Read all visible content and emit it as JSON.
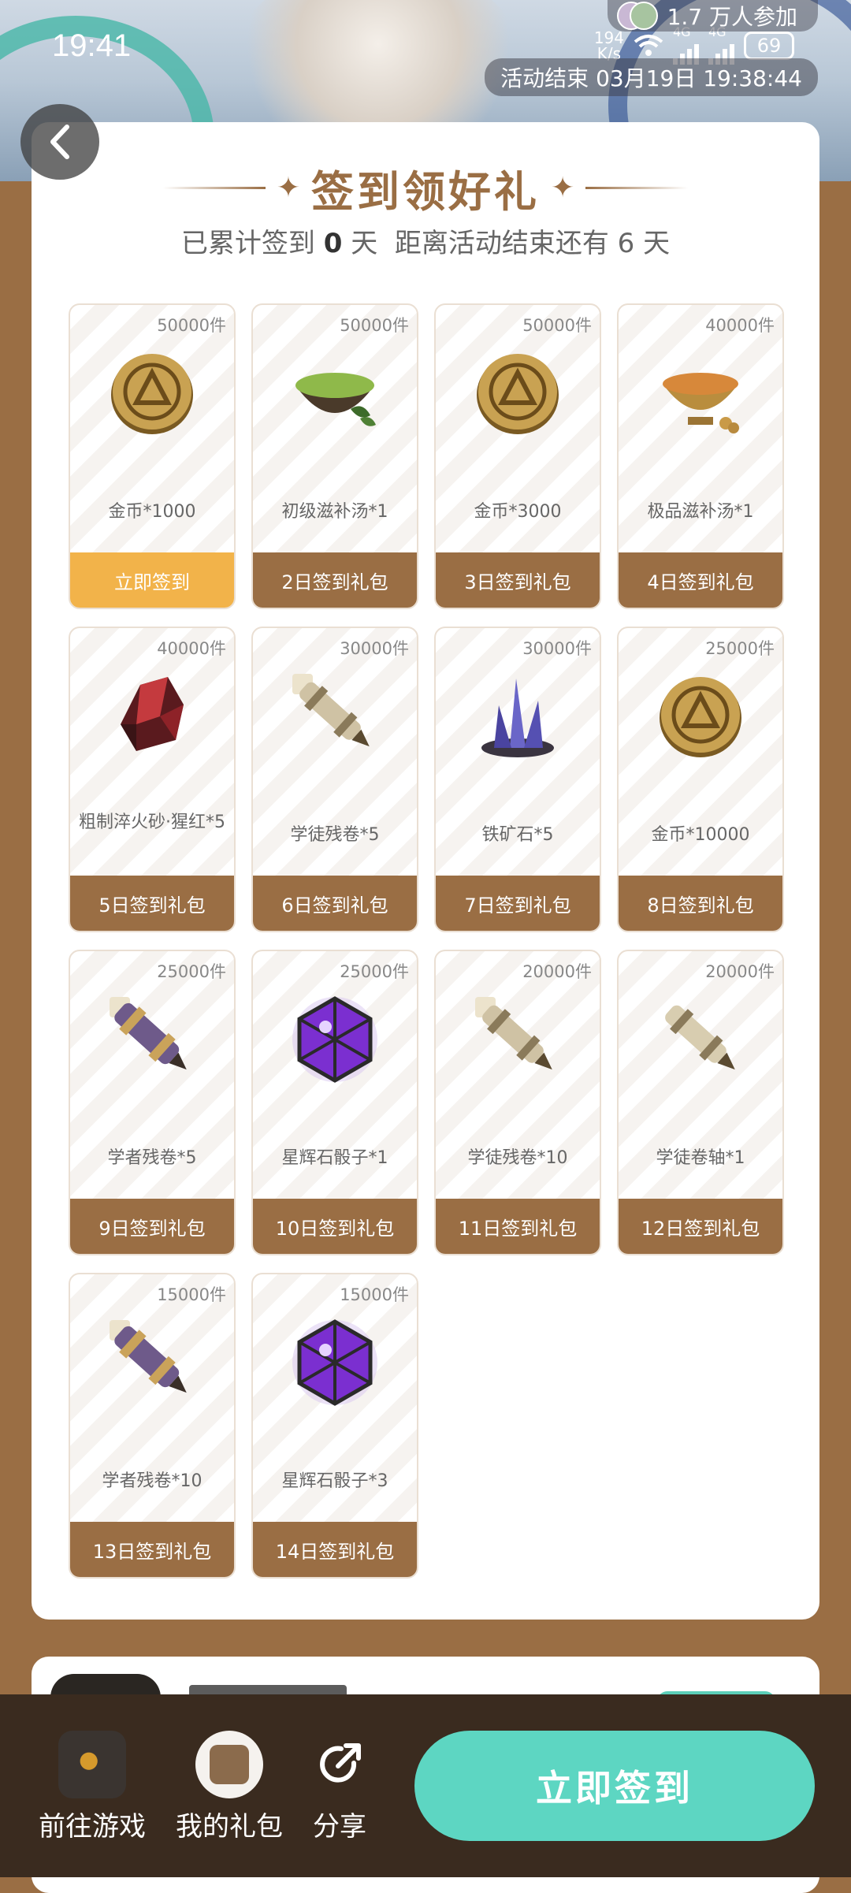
{
  "status_bar": {
    "time": "19:41",
    "net_speed_value": "194",
    "net_speed_unit": "K/s",
    "signal_1": "4G",
    "signal_2": "4G",
    "battery": "69"
  },
  "banner": {
    "participants": "1.7 万人参加",
    "event_end": "活动结束 03月19日 19:38:44"
  },
  "header": {
    "title": "签到领好礼",
    "subtitle_prefix": "已累计签到",
    "signed_days": "0",
    "subtitle_mid": "天  距离活动结束还有",
    "remaining_days": "6",
    "subtitle_suffix": "天"
  },
  "rewards": [
    {
      "stock": "50000件",
      "name": "金币*1000",
      "claim": "立即签到",
      "icon": "gold-coin-icon"
    },
    {
      "stock": "50000件",
      "name": "初级滋补汤*1",
      "claim": "2日签到礼包",
      "icon": "green-soup-bowl-icon"
    },
    {
      "stock": "50000件",
      "name": "金币*3000",
      "claim": "3日签到礼包",
      "icon": "gold-coin-icon"
    },
    {
      "stock": "40000件",
      "name": "极品滋补汤*1",
      "claim": "4日签到礼包",
      "icon": "golden-soup-bowl-icon"
    },
    {
      "stock": "40000件",
      "name": "粗制淬火砂·猩红*5",
      "claim": "5日签到礼包",
      "icon": "red-crystal-icon"
    },
    {
      "stock": "30000件",
      "name": "学徒残卷*5",
      "claim": "6日签到礼包",
      "icon": "scroll-fragment-icon"
    },
    {
      "stock": "30000件",
      "name": "铁矿石*5",
      "claim": "7日签到礼包",
      "icon": "iron-ore-crystal-icon"
    },
    {
      "stock": "25000件",
      "name": "金币*10000",
      "claim": "8日签到礼包",
      "icon": "gold-coin-icon"
    },
    {
      "stock": "25000件",
      "name": "学者残卷*5",
      "claim": "9日签到礼包",
      "icon": "scholar-scroll-fragment-icon"
    },
    {
      "stock": "25000件",
      "name": "星辉石骰子*1",
      "claim": "10日签到礼包",
      "icon": "star-dice-icon"
    },
    {
      "stock": "20000件",
      "name": "学徒残卷*10",
      "claim": "11日签到礼包",
      "icon": "scroll-fragment-icon"
    },
    {
      "stock": "20000件",
      "name": "学徒卷轴*1",
      "claim": "12日签到礼包",
      "icon": "scroll-icon"
    },
    {
      "stock": "15000件",
      "name": "学者残卷*10",
      "claim": "13日签到礼包",
      "icon": "scholar-scroll-fragment-icon"
    },
    {
      "stock": "15000件",
      "name": "星辉石骰子*3",
      "claim": "14日签到礼包",
      "icon": "star-dice-icon"
    }
  ],
  "bottom_bar": {
    "go_game": "前往游戏",
    "my_gifts": "我的礼包",
    "share": "分享",
    "sign_in": "立即签到"
  },
  "colors": {
    "brown": "#9a6e44",
    "active_claim": "#f2b34a",
    "mint_button": "#5dd6c2",
    "bottom_bar": "#3a2b1f"
  }
}
